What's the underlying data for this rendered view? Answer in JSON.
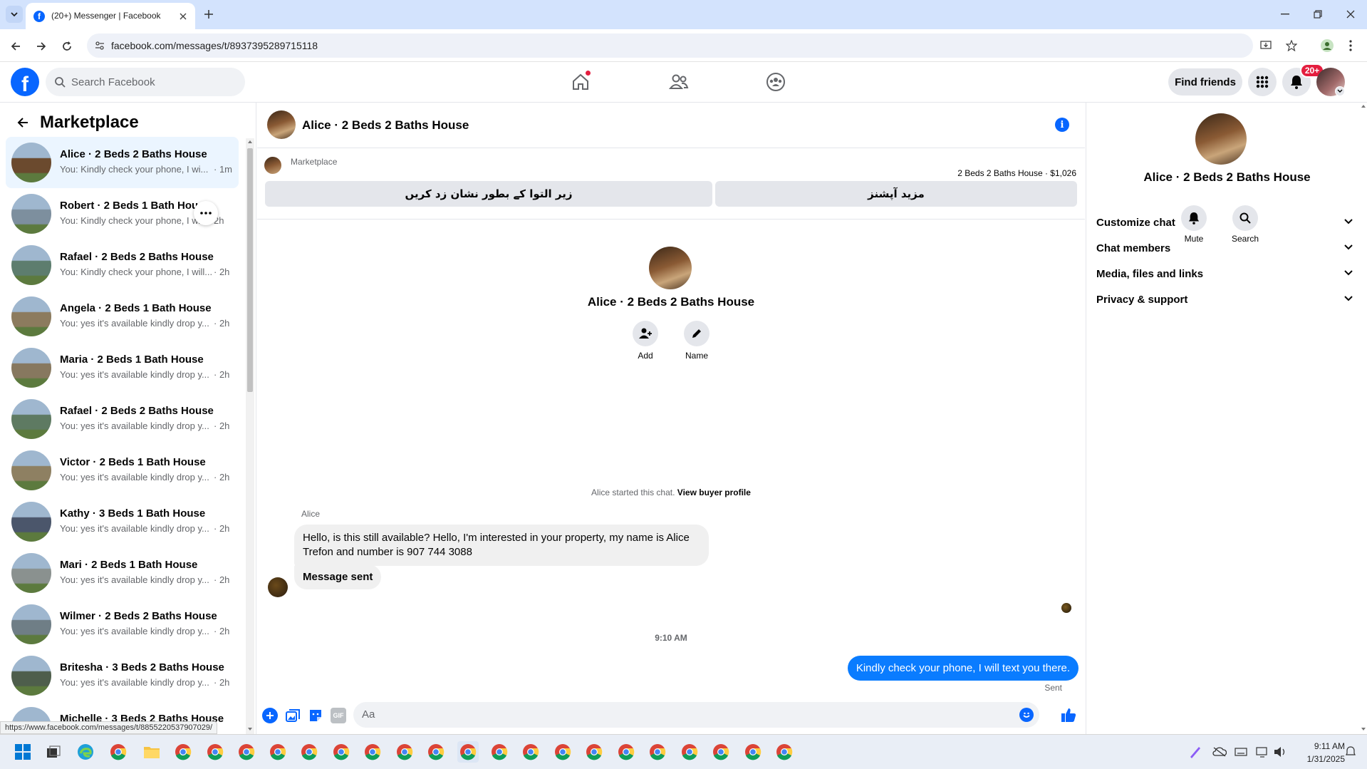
{
  "browser": {
    "tab_title": "(20+) Messenger | Facebook",
    "url": "facebook.com/messages/t/8937395289715118",
    "status_url": "https://www.facebook.com/messages/t/8855220537907029/"
  },
  "fb_header": {
    "search_placeholder": "Search Facebook",
    "find_friends": "Find friends",
    "notif_badge": "20+"
  },
  "sidebar": {
    "title": "Marketplace",
    "conversations": [
      {
        "name": "Alice · 2 Beds 2 Baths House",
        "preview": "You: Kindly check your phone, I wi...",
        "time": "· 1m",
        "color": "#6b4a2e"
      },
      {
        "name": "Robert · 2 Beds 1 Bath House",
        "preview": "You: Kindly check your phone, I w...",
        "time": "2h",
        "color": "#7d8f9e"
      },
      {
        "name": "Rafael · 2 Beds 2 Baths House",
        "preview": "You: Kindly check your phone, I will...",
        "time": "· 2h",
        "color": "#5d7d6e"
      },
      {
        "name": "Angela · 2 Beds 1 Bath House",
        "preview": "You: yes it's available kindly drop y...",
        "time": "· 2h",
        "color": "#8c7b5e"
      },
      {
        "name": "Maria · 2 Beds 1 Bath House",
        "preview": "You: yes it's available kindly drop y...",
        "time": "· 2h",
        "color": "#87785f"
      },
      {
        "name": "Rafael · 2 Beds 2 Baths House",
        "preview": "You: yes it's available kindly drop y...",
        "time": "· 2h",
        "color": "#5e7a62"
      },
      {
        "name": "Victor · 2 Beds 1 Bath House",
        "preview": "You: yes it's available kindly drop y...",
        "time": "· 2h",
        "color": "#8e8062"
      },
      {
        "name": "Kathy · 3 Beds 1 Bath House",
        "preview": "You: yes it's available kindly drop y...",
        "time": "· 2h",
        "color": "#4b566b"
      },
      {
        "name": "Mari · 2 Beds 1 Bath House",
        "preview": "You: yes it's available kindly drop y...",
        "time": "· 2h",
        "color": "#8a918f"
      },
      {
        "name": "Wilmer · 2 Beds 2 Baths House",
        "preview": "You: yes it's available kindly drop y...",
        "time": "· 2h",
        "color": "#6f7e86"
      },
      {
        "name": "Britesha · 3 Beds 2 Baths House",
        "preview": "You: yes it's available kindly drop y...",
        "time": "· 2h",
        "color": "#4e5e4c"
      },
      {
        "name": "Michelle · 3 Beds 2 Baths House",
        "preview": "",
        "time": "",
        "color": "#7a8a90"
      }
    ]
  },
  "chat": {
    "title": "Alice · 2 Beds 2 Baths House",
    "marketplace_label": "Marketplace",
    "listing": "2 Beds 2 Baths House · $1,026",
    "btn_pending": "زیر التوا کے بطور نشان زد کریں",
    "btn_more": "مزید آپشنز",
    "profile_name": "Alice · 2 Beds 2 Baths House",
    "add_label": "Add",
    "name_label": "Name",
    "started_text": "Alice started this chat.",
    "buyer_profile": "View buyer profile",
    "sender": "Alice",
    "msg1": "Hello, is this still available? Hello, I'm interested in your property, my name is Alice Trefon and number is 907 744 3088",
    "msg2": "Message sent",
    "time_sep": "9:10 AM",
    "my_msg": "Kindly check your phone, I will text you there.",
    "status": "Sent",
    "composer_placeholder": "Aa"
  },
  "right": {
    "name": "Alice · 2 Beds 2 Baths House",
    "mute": "Mute",
    "search": "Search",
    "sections": [
      "Customize chat",
      "Chat members",
      "Media, files and links",
      "Privacy & support"
    ]
  },
  "taskbar": {
    "time": "9:11 AM",
    "date": "1/31/2025"
  },
  "colors": {
    "accent": "#0866ff",
    "messenger_blue": "#0a7cff",
    "badge": "#e41e3f"
  }
}
